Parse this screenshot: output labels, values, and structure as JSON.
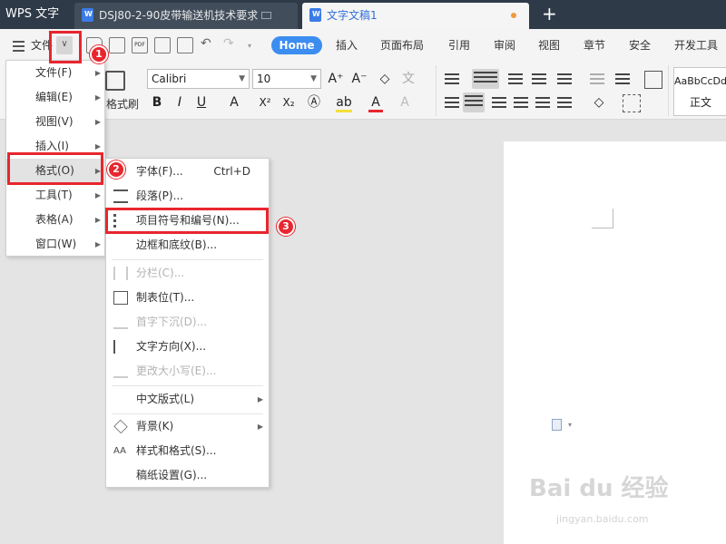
{
  "tabbar": {
    "app_name": "WPS 文字",
    "tabs": [
      {
        "label": "DSJ80-2-90皮带输送机技术要求"
      },
      {
        "label": "文字文稿1"
      }
    ],
    "new_tab": "+"
  },
  "menubar": {
    "file_label": "文件",
    "home": "Home",
    "tabs": [
      "插入",
      "页面布局",
      "引用",
      "审阅",
      "视图",
      "章节",
      "安全",
      "开发工具"
    ]
  },
  "ribbon": {
    "format_painter": "格式刷",
    "font_name": "Calibri",
    "font_size": "10",
    "style_sample": "AaBbCcDd",
    "style_name": "正文",
    "bold": "B",
    "italic": "I",
    "underline": "U",
    "font_color": "A",
    "superscript": "X²",
    "subscript": "X₂",
    "grow_font": "A⁺",
    "shrink_font": "A⁻"
  },
  "file_menu": {
    "items": [
      {
        "label": "文件(F)",
        "submenu": true
      },
      {
        "label": "编辑(E)",
        "submenu": true
      },
      {
        "label": "视图(V)",
        "submenu": true
      },
      {
        "label": "插入(I)",
        "submenu": true
      },
      {
        "label": "格式(O)",
        "submenu": true
      },
      {
        "label": "工具(T)",
        "submenu": true
      },
      {
        "label": "表格(A)",
        "submenu": true
      },
      {
        "label": "窗口(W)",
        "submenu": true
      }
    ]
  },
  "format_menu": {
    "items": [
      {
        "label": "字体(F)...",
        "shortcut": "Ctrl+D",
        "icon": "font-icon"
      },
      {
        "label": "段落(P)...",
        "icon": "paragraph-icon"
      },
      {
        "label": "项目符号和编号(N)...",
        "icon": "list-icon"
      },
      {
        "label": "边框和底纹(B)...",
        "icon": ""
      },
      {
        "label": "分栏(C)...",
        "icon": "columns-icon",
        "disabled": true
      },
      {
        "label": "制表位(T)...",
        "icon": "tab-stop-icon"
      },
      {
        "label": "首字下沉(D)...",
        "icon": "drop-cap-icon",
        "disabled": true
      },
      {
        "label": "文字方向(X)...",
        "icon": "text-direction-icon"
      },
      {
        "label": "更改大小写(E)...",
        "icon": "change-case-icon",
        "disabled": true
      },
      {
        "label": "中文版式(L)",
        "icon": "",
        "submenu": true
      },
      {
        "label": "背景(K)",
        "icon": "background-icon",
        "submenu": true
      },
      {
        "label": "样式和格式(S)...",
        "icon": "styles-icon"
      },
      {
        "label": "稿纸设置(G)...",
        "icon": ""
      }
    ]
  },
  "annotations": {
    "step1": "1",
    "step2": "2",
    "step3": "3"
  },
  "watermark": {
    "brand": "Bai du 经验",
    "url": "jingyan.baidu.com"
  },
  "colors": {
    "tabbar_bg": "#2e3a48",
    "accent": "#3c8df0",
    "highlight": "#e8262e"
  }
}
